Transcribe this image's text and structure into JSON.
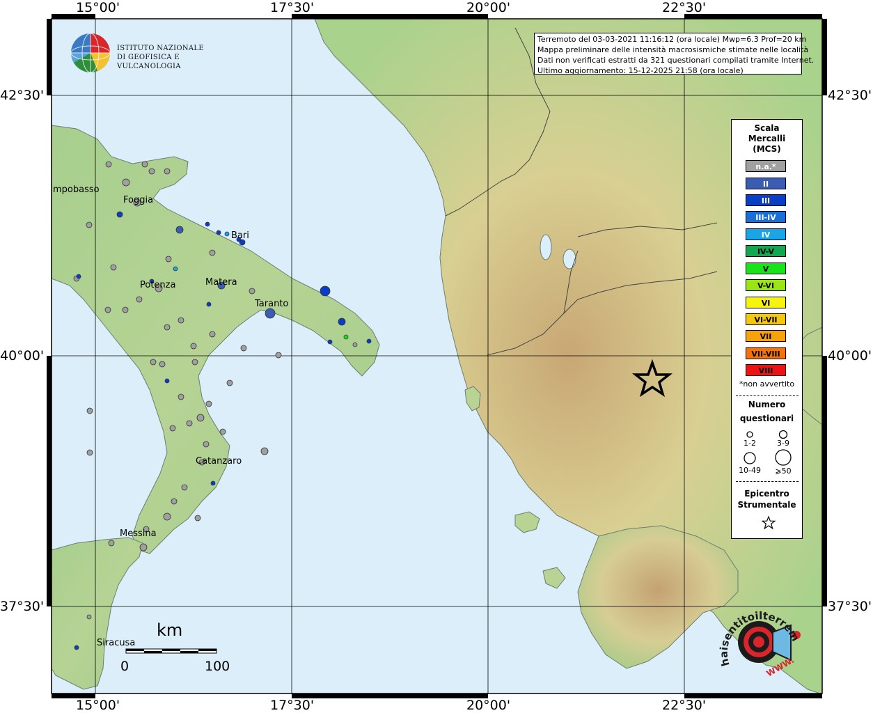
{
  "header": {
    "lines": [
      "Terremoto del 03-03-2021 11:16:12 (ora locale) Mwp=6.3 Prof=20 km",
      "Mappa preliminare delle intensità macrosismiche stimate nelle località",
      "Dati non verificati estratti da 321 questionari compilati tramite Internet.",
      "Ultimo aggiornamento: 15-12-2025 21:58 (ora locale)"
    ]
  },
  "logo": {
    "line1": "ISTITUTO NAZIONALE",
    "line2": "DI GEOFISICA E VULCANOLOGIA"
  },
  "axes": {
    "top": [
      "15°00'",
      "17°30'",
      "20°00'",
      "22°30'"
    ],
    "bottom": [
      "15°00'",
      "17°30'",
      "20°00'",
      "22°30'"
    ],
    "left": [
      "42°30'",
      "40°00'",
      "37°30'"
    ],
    "right": [
      "42°30'",
      "40°00'",
      "37°30'"
    ]
  },
  "cities": [
    {
      "name": "mpobasso"
    },
    {
      "name": "Foggia"
    },
    {
      "name": "Bari"
    },
    {
      "name": "Potenza"
    },
    {
      "name": "Matera"
    },
    {
      "name": "Taranto"
    },
    {
      "name": "Catanzaro"
    },
    {
      "name": "Messina"
    },
    {
      "name": "Siracusa"
    }
  ],
  "legend": {
    "title_lines": [
      "Scala",
      "Mercalli",
      "(MCS)"
    ],
    "scale": [
      {
        "label": "n.a.*",
        "color": "#a0a0a0",
        "text_color": "#ffffff"
      },
      {
        "label": "II",
        "color": "#3a5db3",
        "text_color": "#ffffff"
      },
      {
        "label": "III",
        "color": "#0b3ec6",
        "text_color": "#ffffff"
      },
      {
        "label": "III-IV",
        "color": "#1a6fd6",
        "text_color": "#ffffff"
      },
      {
        "label": "IV",
        "color": "#19a5e6",
        "text_color": "#ffffff"
      },
      {
        "label": "IV-V",
        "color": "#13a84f",
        "text_color": "#000000"
      },
      {
        "label": "V",
        "color": "#19e31b",
        "text_color": "#000000"
      },
      {
        "label": "V-VI",
        "color": "#9ae614",
        "text_color": "#000000"
      },
      {
        "label": "VI",
        "color": "#f6f40c",
        "text_color": "#000000"
      },
      {
        "label": "VI-VII",
        "color": "#f5c70a",
        "text_color": "#000000"
      },
      {
        "label": "VII",
        "color": "#f6a20b",
        "text_color": "#000000"
      },
      {
        "label": "VII-VIII",
        "color": "#f4720a",
        "text_color": "#000000"
      },
      {
        "label": "VIII",
        "color": "#ee1313",
        "text_color": "#000000"
      }
    ],
    "not_felt": "*non avvertito",
    "count_title_1": "Numero",
    "count_title_2": "questionari",
    "count_labels": [
      "1-2",
      "3-9",
      "10-49",
      "⩾50"
    ],
    "epi_title_1": "Epicentro",
    "epi_title_2": "Strumentale"
  },
  "scalebar": {
    "unit": "km",
    "min": "0",
    "max": "100"
  },
  "sentito": {
    "text": "haisentitoilterremoto.it",
    "url": "WWW."
  },
  "colors": {
    "sea": "#dceefa",
    "land_low": "#9ccb86",
    "land_mid": "#d6c68a",
    "land_high": "#b8956a",
    "epicenter_outline": "#000000"
  }
}
